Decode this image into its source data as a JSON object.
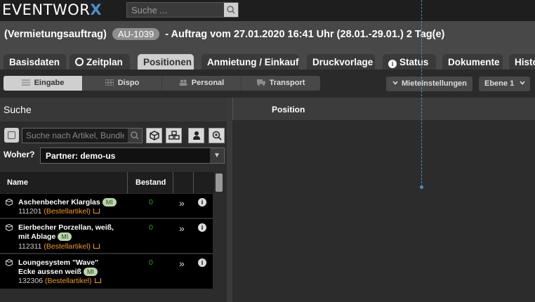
{
  "app": {
    "logo_text": "EVENTWOR",
    "logo_x": "X",
    "search_placeholder": "Suche ..."
  },
  "header": {
    "title_prefix": "(Vermietungsauftrag)",
    "order_badge": "AU-1039",
    "title_suffix": "- Auftrag vom 27.01.2020 16:41 Uhr (28.01.-29.01.) 2 Tag(e)"
  },
  "tabs": [
    {
      "label": "Basisdaten",
      "icon": ""
    },
    {
      "label": "Zeitplan",
      "icon": "clock-icon"
    },
    {
      "label": "Positionen",
      "icon": "",
      "active": true
    },
    {
      "label": "Anmietung / Einkauf",
      "icon": ""
    },
    {
      "label": "Druckvorlage",
      "icon": ""
    },
    {
      "label": "Status",
      "icon": "info-icon"
    },
    {
      "label": "Dokumente",
      "icon": ""
    },
    {
      "label": "Historie",
      "icon": ""
    }
  ],
  "subnav": {
    "modes": [
      {
        "label": "Eingabe",
        "icon": "list-icon",
        "active": true
      },
      {
        "label": "Dispo",
        "icon": "grid-icon"
      },
      {
        "label": "Personal",
        "icon": "users-icon"
      },
      {
        "label": "Transport",
        "icon": "truck-icon"
      }
    ],
    "rent_settings_label": "Mieteinstellungen",
    "level_label": "Ebene 1"
  },
  "search_panel": {
    "title": "Suche",
    "search_placeholder": "Suche nach Artikel, Bundle",
    "woher_label": "Woher?",
    "partner_value": "Partner: demo-us",
    "columns": {
      "name": "Name",
      "stock": "Bestand"
    },
    "items": [
      {
        "name": "Aschenbecher Klarglas",
        "badge": "MI",
        "code": "111201",
        "tag": "(Bestellartikel)",
        "stock": "0"
      },
      {
        "name": "Eierbecher Porzellan, weiß, mit Ablage",
        "badge": "MI",
        "code": "112311",
        "tag": "(Bestellartikel)",
        "stock": "0"
      },
      {
        "name": "Loungesystem \"Wave\" Ecke aussen weiß",
        "badge": "MI",
        "code": "132306",
        "tag": "(Bestellartikel)",
        "stock": "0"
      }
    ]
  },
  "positions_panel": {
    "column_position": "Position"
  },
  "colors": {
    "accent_blue": "#4a8ec9",
    "stock_green": "#2fa12f",
    "order_orange": "#f59a1a",
    "badge_green": "#b9d7a8"
  }
}
